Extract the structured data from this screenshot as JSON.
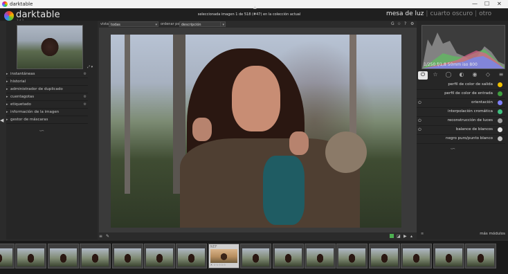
{
  "window": {
    "title": "darktable",
    "controls": [
      "—",
      "☐",
      "✕"
    ]
  },
  "app": {
    "logo_text": "darktable",
    "version": "2.4.2"
  },
  "status": "seleccionada imagen 1 de 518 (#47) en la colección actual",
  "views": {
    "active": "mesa de luz",
    "items": [
      "cuarto oscuro",
      "otro"
    ]
  },
  "left_panel": {
    "items": [
      {
        "label": "instantáneas",
        "indicator": "⚙"
      },
      {
        "label": "historial",
        "indicator": ""
      },
      {
        "label": "administrador de duplicado",
        "indicator": ""
      },
      {
        "label": "cuentagotas",
        "indicator": "⚙"
      },
      {
        "label": "etiquetado",
        "indicator": "⚙"
      },
      {
        "label": "información de la imagen",
        "indicator": ""
      },
      {
        "label": "gestor de máscaras",
        "indicator": ""
      }
    ]
  },
  "toolbar": {
    "view_label": "vista",
    "view_value": "todas",
    "sort_label": "ordenar por",
    "sort_value": "descripción",
    "icons": [
      "G",
      "☆",
      "?",
      "⚙"
    ]
  },
  "histogram": {
    "label": "1/250 f/1,8 50mm iso 800"
  },
  "module_tabs": [
    "⏻",
    "☆",
    "◯",
    "◐",
    "◉",
    "◇",
    "≡"
  ],
  "modules": [
    {
      "label": "perfil de color de salida",
      "icon_color": "#f0c000",
      "power": ""
    },
    {
      "label": "perfil de color de entrada",
      "icon_color": "#40a040",
      "power": ""
    },
    {
      "label": "orientación",
      "icon_color": "#8080ff",
      "power": "⏻"
    },
    {
      "label": "interpolación cromática",
      "icon_color": "#40c080",
      "power": ""
    },
    {
      "label": "reconstrucción de luces",
      "icon_color": "#a0a0a0",
      "power": "⏻"
    },
    {
      "label": "balance de blancos",
      "icon_color": "#e0e0e0",
      "power": "⏻"
    },
    {
      "label": "negro puro/punto blanco",
      "icon_color": "#c0c0c0",
      "power": ""
    }
  ],
  "more_modules": "más módulos",
  "filmstrip": {
    "selected_index": 7,
    "selected_badge": "NEF",
    "selected_stars": "✕ ☆☆☆☆☆",
    "count": 15
  }
}
